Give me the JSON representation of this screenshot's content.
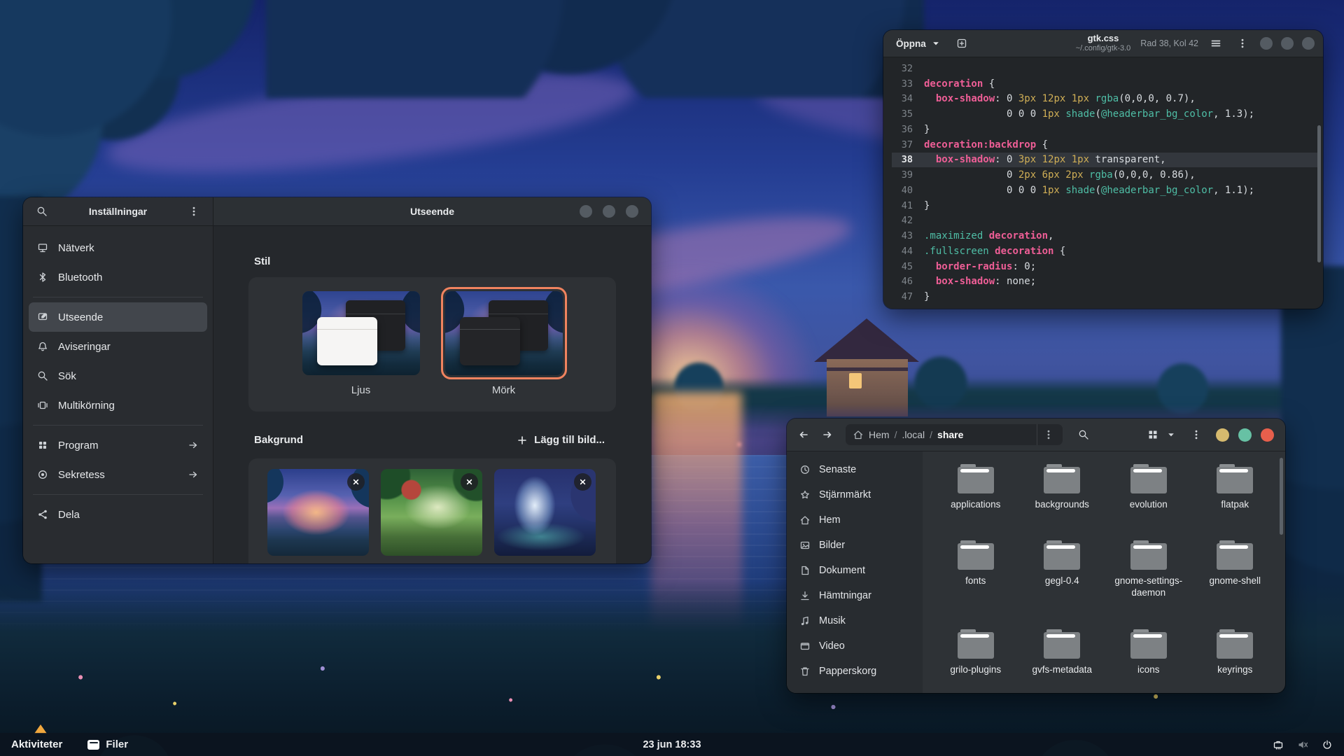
{
  "taskbar": {
    "activities": "Aktiviteter",
    "app": "Filer",
    "clock": "23 jun 18:33",
    "tray_icons": [
      "ethernet-icon",
      "volume-muted-icon",
      "power-icon"
    ]
  },
  "editor": {
    "header": {
      "open_label": "Öppna",
      "title": "gtk.css",
      "subtitle": "~/.config/gtk-3.0",
      "cursor_position": "Rad 38, Kol 42"
    },
    "current_line": 38,
    "lines": [
      {
        "n": "32",
        "t": []
      },
      {
        "n": "33",
        "t": [
          [
            "sel",
            "decoration"
          ],
          [
            "p",
            " {"
          ]
        ]
      },
      {
        "n": "34",
        "t": [
          [
            "p",
            "  "
          ],
          [
            "sel",
            "box-shadow"
          ],
          [
            "p",
            ": 0 "
          ],
          [
            "num",
            "3px 12px 1px"
          ],
          [
            "p",
            " "
          ],
          [
            "fn",
            "rgba"
          ],
          [
            "p",
            "(0,0,0, 0.7),"
          ]
        ]
      },
      {
        "n": "35",
        "t": [
          [
            "p",
            "              0 0 0 "
          ],
          [
            "num",
            "1px"
          ],
          [
            "p",
            " "
          ],
          [
            "fn",
            "shade"
          ],
          [
            "p",
            "("
          ],
          [
            "fn",
            "@headerbar_bg_color"
          ],
          [
            "p",
            ", 1.3);"
          ]
        ]
      },
      {
        "n": "36",
        "t": [
          [
            "p",
            "}"
          ]
        ]
      },
      {
        "n": "37",
        "t": [
          [
            "sel",
            "decoration:backdrop"
          ],
          [
            "p",
            " {"
          ]
        ]
      },
      {
        "n": "38",
        "cur": true,
        "t": [
          [
            "p",
            "  "
          ],
          [
            "sel",
            "box-shadow"
          ],
          [
            "p",
            ": 0 "
          ],
          [
            "num",
            "3px 12px 1px"
          ],
          [
            "p",
            " transparent,"
          ]
        ]
      },
      {
        "n": "39",
        "t": [
          [
            "p",
            "              0 "
          ],
          [
            "num",
            "2px 6px 2px"
          ],
          [
            "p",
            " "
          ],
          [
            "fn",
            "rgba"
          ],
          [
            "p",
            "(0,0,0, 0.86),"
          ]
        ]
      },
      {
        "n": "40",
        "t": [
          [
            "p",
            "              0 0 0 "
          ],
          [
            "num",
            "1px"
          ],
          [
            "p",
            " "
          ],
          [
            "fn",
            "shade"
          ],
          [
            "p",
            "("
          ],
          [
            "fn",
            "@headerbar_bg_color"
          ],
          [
            "p",
            ", 1.1);"
          ]
        ]
      },
      {
        "n": "41",
        "t": [
          [
            "p",
            "}"
          ]
        ]
      },
      {
        "n": "42",
        "t": []
      },
      {
        "n": "43",
        "t": [
          [
            "fn",
            ".maximized"
          ],
          [
            "p",
            " "
          ],
          [
            "sel",
            "decoration"
          ],
          [
            "p",
            ","
          ]
        ]
      },
      {
        "n": "44",
        "t": [
          [
            "fn",
            ".fullscreen"
          ],
          [
            "p",
            " "
          ],
          [
            "sel",
            "decoration"
          ],
          [
            "p",
            " {"
          ]
        ]
      },
      {
        "n": "45",
        "t": [
          [
            "p",
            "  "
          ],
          [
            "sel",
            "border-radius"
          ],
          [
            "p",
            ": 0;"
          ]
        ]
      },
      {
        "n": "46",
        "t": [
          [
            "p",
            "  "
          ],
          [
            "sel",
            "box-shadow"
          ],
          [
            "p",
            ": none;"
          ]
        ]
      },
      {
        "n": "47",
        "t": [
          [
            "p",
            "}"
          ]
        ]
      }
    ]
  },
  "settings": {
    "sidebar_title": "Inställningar",
    "items": [
      {
        "key": "natverk",
        "label": "Nätverk",
        "icon": "network-icon",
        "group": 0
      },
      {
        "key": "bluetooth",
        "label": "Bluetooth",
        "icon": "bluetooth-icon",
        "group": 0
      },
      {
        "key": "utseende",
        "label": "Utseende",
        "icon": "appearance-icon",
        "group": 1,
        "selected": true
      },
      {
        "key": "aviseringar",
        "label": "Aviseringar",
        "icon": "bell-icon",
        "group": 1
      },
      {
        "key": "sok",
        "label": "Sök",
        "icon": "search-icon",
        "group": 1
      },
      {
        "key": "multikorning",
        "label": "Multikörning",
        "icon": "multitask-icon",
        "group": 1
      },
      {
        "key": "program",
        "label": "Program",
        "icon": "apps-icon",
        "group": 2,
        "arrow": true
      },
      {
        "key": "sekretess",
        "label": "Sekretess",
        "icon": "privacy-icon",
        "group": 2,
        "arrow": true
      },
      {
        "key": "dela",
        "label": "Dela",
        "icon": "share-icon",
        "group": 3
      }
    ],
    "page_title": "Utseende",
    "style_heading": "Stil",
    "style_options": [
      {
        "label": "Ljus",
        "selected": false
      },
      {
        "label": "Mörk",
        "selected": true
      }
    ],
    "background_heading": "Bakgrund",
    "add_image_label": "Lägg till bild...",
    "accent_color": "#f0835f",
    "background_thumbnails": [
      "sunset-lake-wallpaper",
      "garden-wallpaper",
      "blue-canyon-wallpaper"
    ]
  },
  "files": {
    "path": [
      "Hem",
      ".local",
      "share"
    ],
    "sidebar": [
      {
        "key": "senaste",
        "label": "Senaste",
        "icon": "recent-icon"
      },
      {
        "key": "stjarnmarkt",
        "label": "Stjärnmärkt",
        "icon": "star-icon"
      },
      {
        "key": "hem",
        "label": "Hem",
        "icon": "home-icon"
      },
      {
        "key": "bilder",
        "label": "Bilder",
        "icon": "images-icon"
      },
      {
        "key": "dokument",
        "label": "Dokument",
        "icon": "documents-icon"
      },
      {
        "key": "hamtningar",
        "label": "Hämtningar",
        "icon": "downloads-icon"
      },
      {
        "key": "musik",
        "label": "Musik",
        "icon": "music-icon"
      },
      {
        "key": "video",
        "label": "Video",
        "icon": "video-icon"
      },
      {
        "key": "papperskorg",
        "label": "Papperskorg",
        "icon": "trash-icon"
      }
    ],
    "folders": [
      "applications",
      "backgrounds",
      "evolution",
      "flatpak",
      "fonts",
      "gegl-0.4",
      "gnome-settings-daemon",
      "gnome-shell",
      "grilo-plugins",
      "gvfs-metadata",
      "icons",
      "keyrings"
    ],
    "window_buttons": [
      "#d6ba6e",
      "#67c1a4",
      "#e75f4c"
    ]
  }
}
